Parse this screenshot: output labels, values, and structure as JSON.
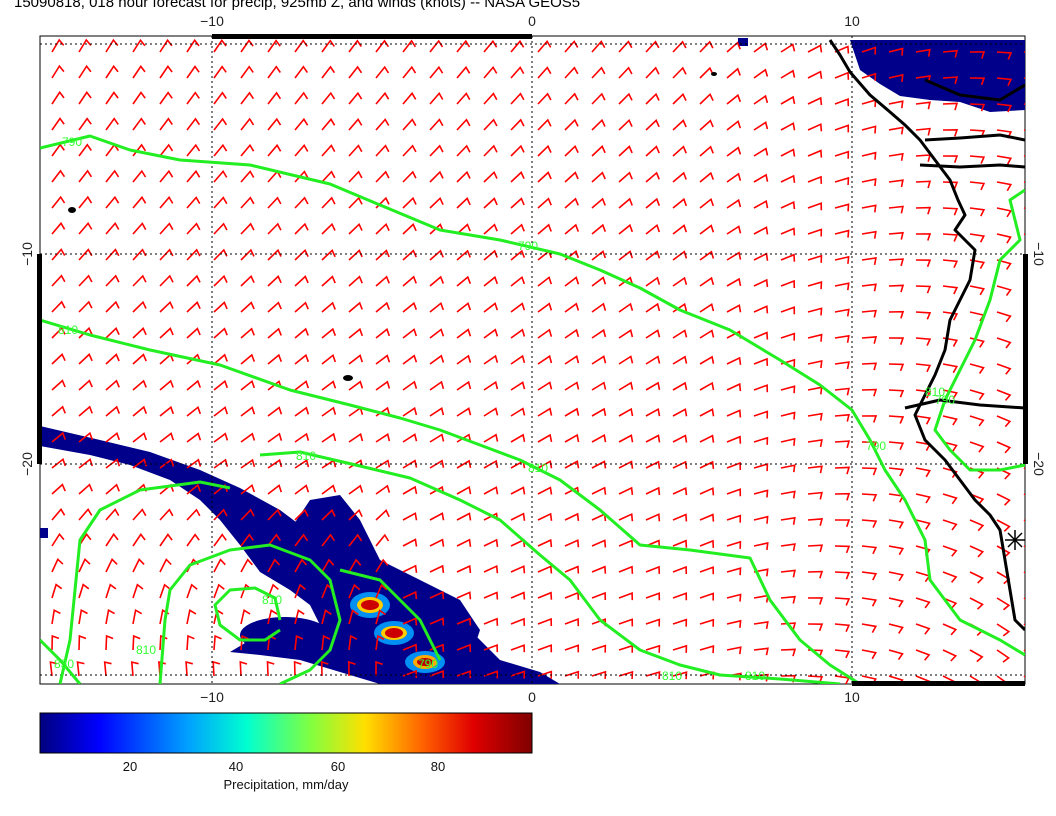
{
  "title": "15090818, 018 hour forecast for precip, 925mb Z, and winds (knots) -- NASA GEOS5",
  "map": {
    "lon_ticks_top": [
      "−10",
      "0",
      "10"
    ],
    "lon_ticks_bottom": [
      "−10",
      "0",
      "10"
    ],
    "lat_ticks_left": [
      "−10",
      "−20"
    ],
    "lat_ticks_right": [
      "−10",
      "−20"
    ],
    "contour_labels": [
      "790",
      "790",
      "810",
      "810",
      "810",
      "810",
      "790",
      "790",
      "810",
      "830",
      "810",
      "810",
      "810",
      "790"
    ],
    "colors": {
      "wind_barbs": "#ff0000",
      "geopotential_contours": "#22ee22",
      "coastlines": "#000000",
      "grid": "#000000"
    }
  },
  "colorbar": {
    "tick_labels": [
      "20",
      "40",
      "60",
      "80"
    ],
    "label": "Precipitation, mm/day",
    "colors": [
      "#00007f",
      "#0000ff",
      "#00a0ff",
      "#00ffd0",
      "#80ff40",
      "#ffe000",
      "#ff6000",
      "#e00000",
      "#7f0000"
    ]
  }
}
